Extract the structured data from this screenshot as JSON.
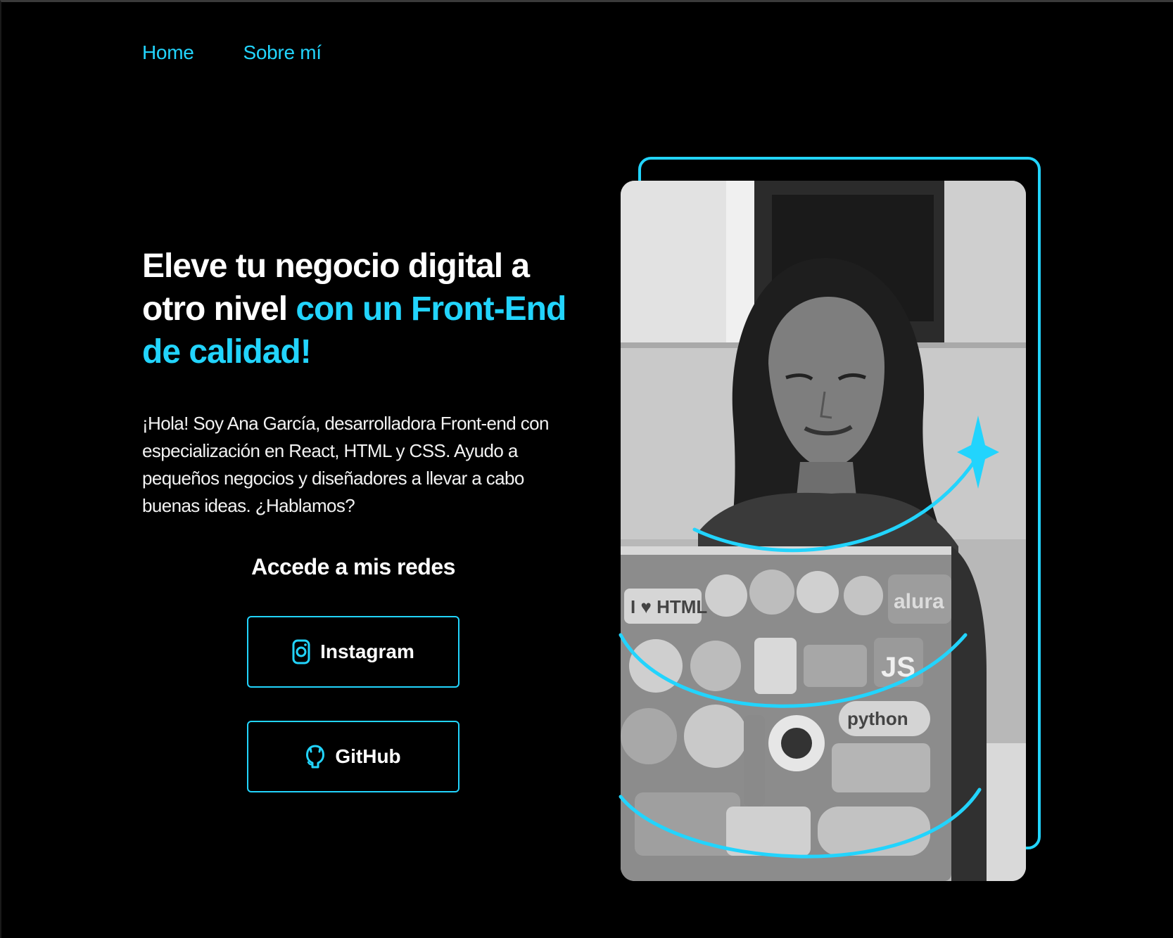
{
  "nav": {
    "home": "Home",
    "about": "Sobre mí"
  },
  "hero": {
    "headline_white": "Eleve tu negocio digital a otro nivel ",
    "headline_accent": "con un Front-End de calidad!",
    "intro": "¡Hola! Soy Ana García, desarrolladora Front-end con especialización en React, HTML y CSS. Ayudo a pequeños negocios y diseñadores a llevar a cabo buenas ideas. ¿Hablamos?"
  },
  "social": {
    "title": "Accede a mis redes",
    "instagram_label": "Instagram",
    "github_label": "GitHub",
    "instagram_icon": "instagram-icon",
    "github_icon": "github-icon"
  },
  "photo": {
    "sticker_text_1": "alura",
    "sticker_text_2": "JS",
    "sticker_text_3": "python",
    "sticker_text_4": "I ♥ HTML"
  },
  "colors": {
    "accent": "#22d4fd",
    "background": "#000000",
    "text": "#ffffff"
  }
}
